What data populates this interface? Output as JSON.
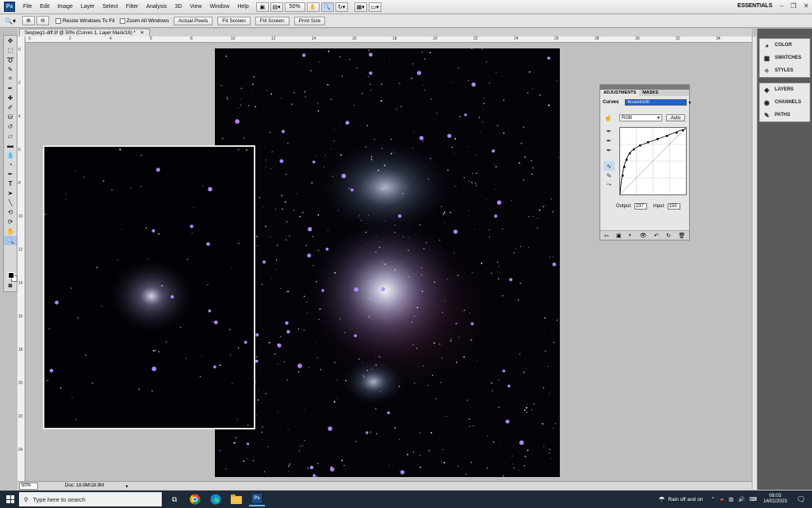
{
  "menu": {
    "logo": "Ps",
    "items": [
      "File",
      "Edit",
      "Image",
      "Layer",
      "Select",
      "Filter",
      "Analysis",
      "3D",
      "View",
      "Window",
      "Help"
    ],
    "zoom": "50%",
    "workspace": "ESSENTIALS"
  },
  "options": {
    "resize_windows": "Resize Windows To Fit",
    "zoom_all": "Zoom All Windows",
    "actual_pixels": "Actual Pixels",
    "fit_screen": "Fit Screen",
    "fill_screen": "Fill Screen",
    "print_size": "Print Size"
  },
  "document": {
    "tab_title": "Seq/peg1-diff.tif @ 50% (Curves 1, Layer Mask/16) *",
    "zoom_status": "50%",
    "doc_status": "Doc: 18.9M/18.9M"
  },
  "ruler": {
    "top": [
      "0",
      "2",
      "4",
      "6",
      "8",
      "10",
      "12",
      "14",
      "16",
      "18",
      "20",
      "22",
      "24",
      "26",
      "28",
      "30",
      "32",
      "34"
    ],
    "left": [
      "0",
      "2",
      "4",
      "6",
      "8",
      "10",
      "12",
      "14",
      "16",
      "18",
      "20",
      "22",
      "24"
    ]
  },
  "dock": {
    "group1": [
      "COLOR",
      "SWATCHES",
      "STYLES"
    ],
    "group2": [
      "LAYERS",
      "CHANNELS",
      "PATHS"
    ]
  },
  "adjustments": {
    "tab_adjustments": "ADJUSTMENTS",
    "tab_masks": "MASKS",
    "label": "Curves",
    "preset": "Arcsinh100",
    "channel": "RGB",
    "auto": "Auto",
    "output_label": "Output:",
    "output_value": "237",
    "input_label": "Input:",
    "input_value": "155"
  },
  "taskbar": {
    "search_placeholder": "Type here to search",
    "weather": "Rain off and on",
    "time": "08:03",
    "date": "14/01/2023"
  }
}
